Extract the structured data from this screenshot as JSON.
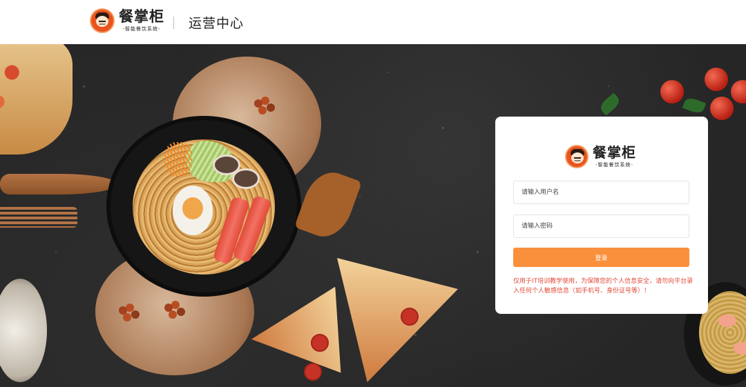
{
  "header": {
    "brand_name": "餐掌柜",
    "brand_tagline": "-智能餐饮系统-",
    "title": "运营中心"
  },
  "login": {
    "brand_name": "餐掌柜",
    "brand_tagline": "-智能餐饮系统-",
    "username_placeholder": "请输入用户名",
    "username_value": "",
    "password_placeholder": "请输入密码",
    "password_value": "",
    "submit_label": "登录",
    "notice": "仅用于IT培训教学使用，为保障您的个人信息安全，请勿向平台录入任何个人敏感信息（如手机号、身份证号等）！"
  },
  "colors": {
    "accent": "#fa8f3c",
    "notice": "#e24b3b",
    "logo": "#e8541c",
    "background": "#262626"
  },
  "icons": [
    "chef-logo-icon"
  ]
}
